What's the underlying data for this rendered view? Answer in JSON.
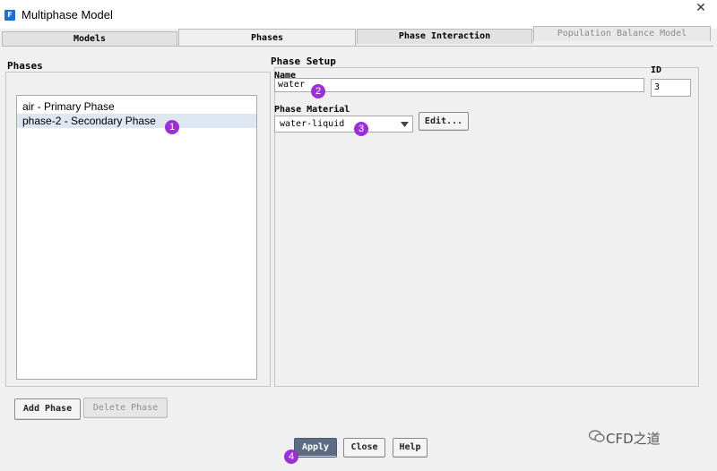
{
  "window": {
    "title": "Multiphase Model",
    "close_glyph": "✕",
    "icon_letter": "F"
  },
  "tabs": [
    {
      "label": "Models",
      "state": "inactive"
    },
    {
      "label": "Phases",
      "state": "active"
    },
    {
      "label": "Phase Interaction",
      "state": "inactive"
    },
    {
      "label": "Population Balance Model",
      "state": "disabled"
    }
  ],
  "phases_panel": {
    "title": "Phases",
    "items": [
      {
        "label": "air - Primary Phase",
        "selected": false
      },
      {
        "label": "phase-2 - Secondary Phase",
        "selected": true
      }
    ],
    "add_button": "Add Phase",
    "delete_button": "Delete Phase"
  },
  "phase_setup": {
    "title": "Phase Setup",
    "name_label": "Name",
    "name_value": "water",
    "id_label": "ID",
    "id_value": "3",
    "material_label": "Phase Material",
    "material_value": "water-liquid",
    "edit_button": "Edit..."
  },
  "footer": {
    "apply": "Apply",
    "close": "Close",
    "help": "Help"
  },
  "annotations": [
    "1",
    "2",
    "3",
    "4"
  ],
  "watermark": "CFD之道",
  "colors": {
    "badge": "#9d2fd6",
    "apply_button": "#5b6d85",
    "selection": "#dde6f1"
  }
}
